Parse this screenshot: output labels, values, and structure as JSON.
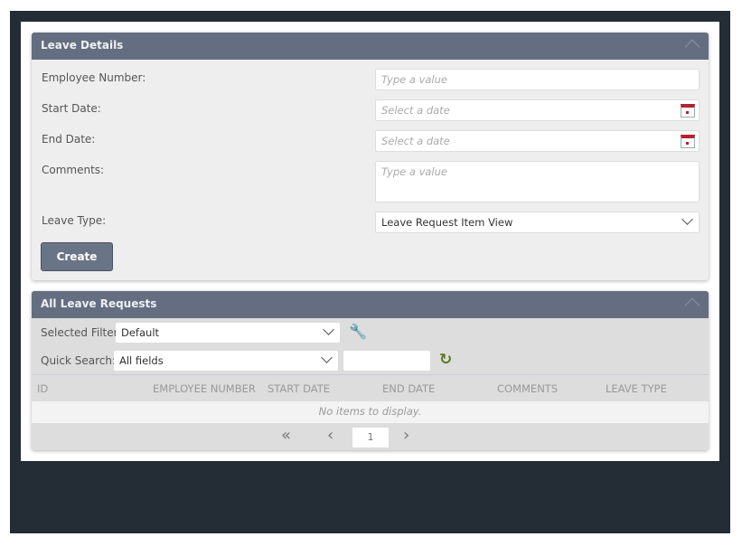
{
  "leave_details": {
    "title": "Leave Details",
    "employee_number_label": "Employee Number:",
    "employee_number_placeholder": "Type a value",
    "start_date_label": "Start Date:",
    "start_date_placeholder": "Select a date",
    "end_date_label": "End Date:",
    "end_date_placeholder": "Select a date",
    "comments_label": "Comments:",
    "comments_placeholder": "Type a value",
    "leave_type_label": "Leave Type:",
    "leave_type_value": "Leave Request Item View",
    "create_label": "Create"
  },
  "all_requests": {
    "title": "All Leave Requests",
    "selected_filter_label": "Selected Filter:",
    "selected_filter_value": "Default",
    "quick_search_label": "Quick Search:",
    "quick_search_value": "All fields",
    "columns": [
      "ID",
      "EMPLOYEE NUMBER",
      "START DATE",
      "END DATE",
      "COMMENTS",
      "LEAVE TYPE"
    ],
    "empty_message": "No items to display.",
    "page": "1"
  }
}
